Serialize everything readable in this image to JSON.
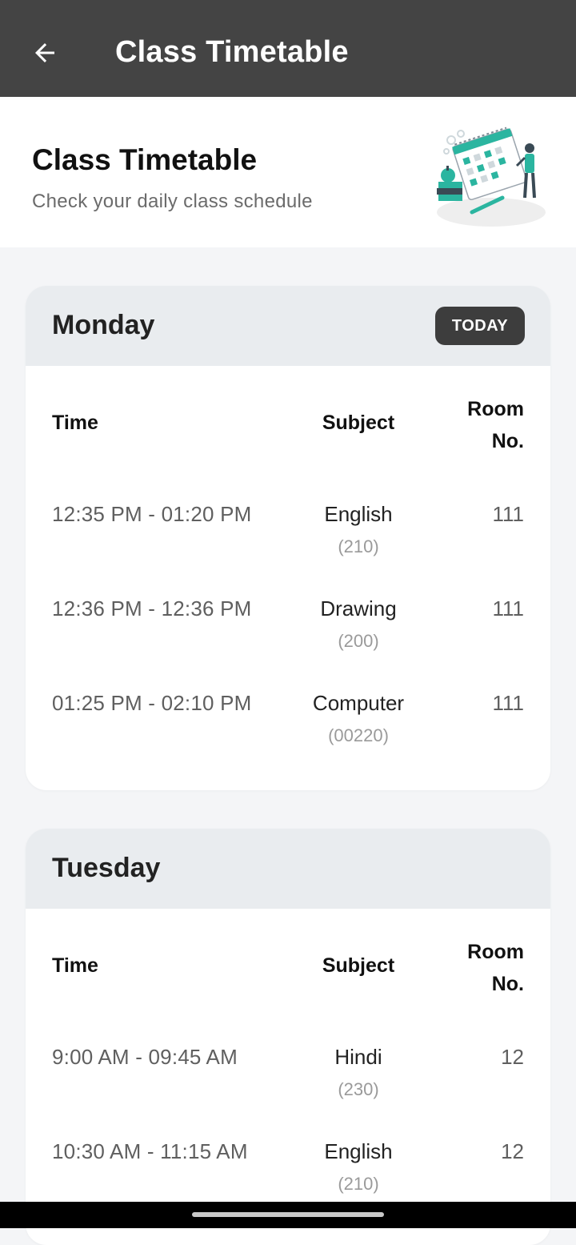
{
  "appbar": {
    "title": "Class Timetable",
    "back_icon": "arrow-left-icon",
    "background": "#444444"
  },
  "header": {
    "title": "Class Timetable",
    "subtitle": "Check your daily class schedule",
    "illustration_icon": "timetable-illustration"
  },
  "columns": {
    "time": "Time",
    "subject": "Subject",
    "room_line1": "Room",
    "room_line2": "No."
  },
  "days": [
    {
      "name": "Monday",
      "badge": "TODAY",
      "rows": [
        {
          "time": "12:35 PM - 01:20 PM",
          "subject": "English",
          "code": "(210)",
          "room": "111"
        },
        {
          "time": "12:36 PM - 12:36 PM",
          "subject": "Drawing",
          "code": "(200)",
          "room": "111"
        },
        {
          "time": "01:25 PM - 02:10 PM",
          "subject": "Computer",
          "code": "(00220)",
          "room": "111"
        }
      ]
    },
    {
      "name": "Tuesday",
      "rows": [
        {
          "time": "9:00 AM - 09:45 AM",
          "subject": "Hindi",
          "code": "(230)",
          "room": "12"
        },
        {
          "time": "10:30 AM - 11:15 AM",
          "subject": "English",
          "code": "(210)",
          "room": "12"
        }
      ]
    }
  ],
  "colors": {
    "accent": "#2bb5a0",
    "badge_bg": "#3d3d3d",
    "card_head": "#e9ecef"
  }
}
